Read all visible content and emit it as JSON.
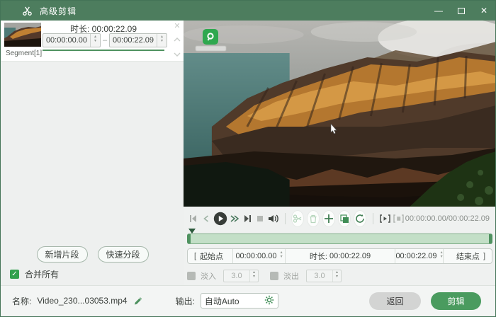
{
  "titlebar": {
    "title": "高级剪辑"
  },
  "icons": {
    "minimize": "—",
    "close": "✕",
    "check": "✓",
    "spin_up": "▴",
    "spin_down": "▾"
  },
  "colors": {
    "titlebar_green": "#4d7d5e",
    "accent_green": "#4f9260",
    "bright_green": "#33a14e",
    "timeline_fill": "#c3dfc7",
    "cut_button_green": "#4a9b5f"
  },
  "segment_panel": {
    "duration_label": "时长:",
    "duration_value": "00:00:22.09",
    "start_time": "00:00:00.00",
    "range_separator": "–",
    "end_time": "00:00:22.09",
    "segment_name": "Segment[1]",
    "add_segment_button": "新增片段",
    "quick_split_button": "快速分段",
    "merge_all_label": "合并所有",
    "merge_all_checked": true
  },
  "player": {
    "time_display": "00:00:00.00/00:00:22.09"
  },
  "trim_bar": {
    "left_bracket": "[",
    "start_point_button": "起始点",
    "start_value": "00:00:00.00",
    "duration_label": "时长:",
    "duration_value": "00:00:22.09",
    "end_value": "00:00:22.09",
    "end_point_button": "结束点",
    "right_bracket": "]"
  },
  "fade_controls": {
    "fade_in_label": "淡入",
    "fade_in_value": "3.0",
    "fade_in_enabled": false,
    "fade_out_label": "淡出",
    "fade_out_value": "3.0",
    "fade_out_enabled": false
  },
  "footer": {
    "name_label": "名称:",
    "file_name": "Video_230...03053.mp4",
    "output_label": "输出:",
    "output_value": "自动Auto",
    "back_button": "返回",
    "cut_button": "剪辑"
  }
}
